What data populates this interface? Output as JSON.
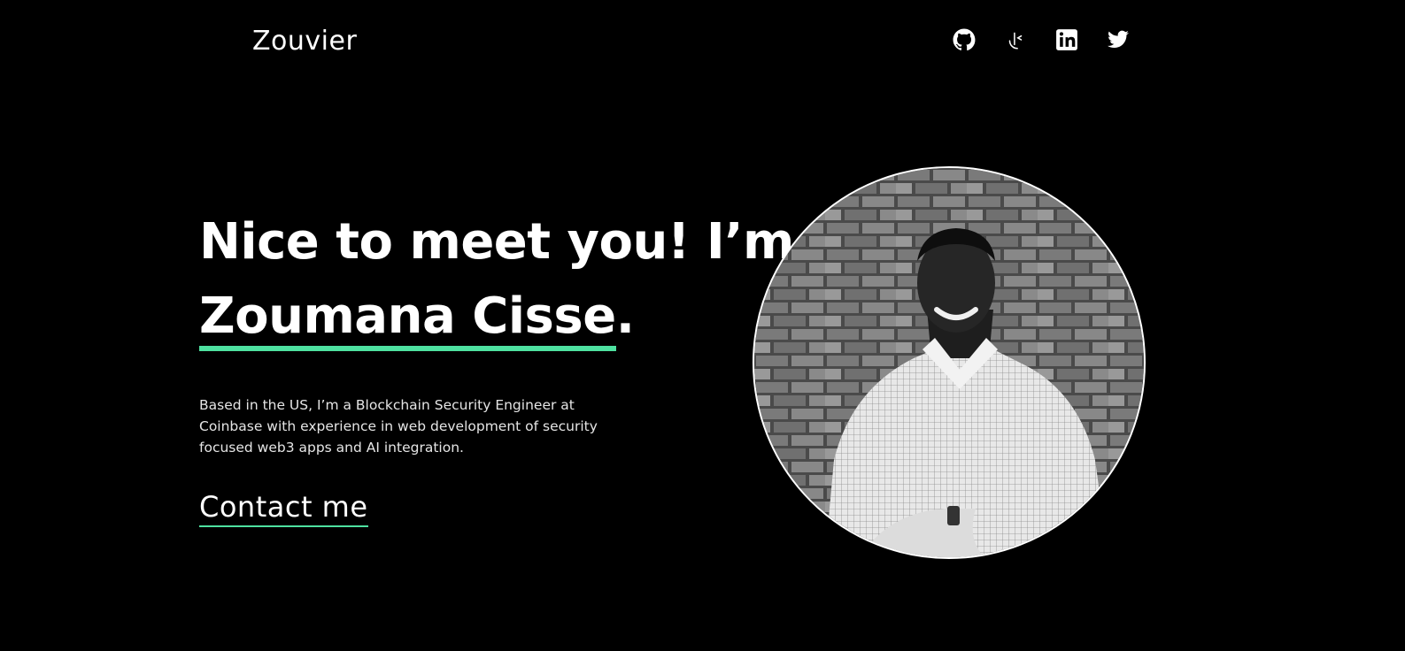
{
  "header": {
    "logo": "Zouvier",
    "socials": [
      {
        "icon": "github-icon"
      },
      {
        "icon": "hackerrank-icon"
      },
      {
        "icon": "linkedin-icon"
      },
      {
        "icon": "twitter-icon"
      }
    ]
  },
  "hero": {
    "headline_prefix": "Nice to meet you! I’m",
    "name": "Zoumana Cisse",
    "name_suffix": ".",
    "intro": "Based in the US, I’m a Blockchain Security Engineer at Coinbase with experience in web development of security focused web3 apps and AI integration.",
    "contact_label": "Contact me"
  },
  "colors": {
    "background": "#000000",
    "text": "#ffffff",
    "accent": "#4ee1a0"
  }
}
